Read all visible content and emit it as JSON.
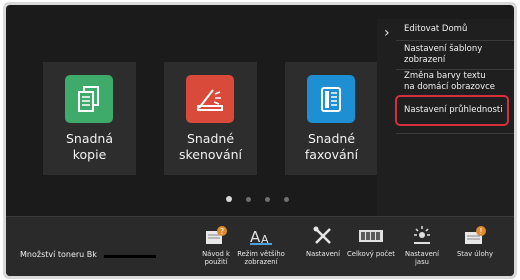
{
  "tiles": [
    {
      "label": "Snadná\nkopie",
      "icon": "copy-icon",
      "color": "#3fab6b"
    },
    {
      "label": "Snadné\nskenování",
      "icon": "scan-icon",
      "color": "#d94a3b"
    },
    {
      "label": "Snadné\nfaxování",
      "icon": "fax-icon",
      "color": "#1f8fd3"
    }
  ],
  "page_indicator": {
    "pages": 4,
    "current": 1
  },
  "menu": {
    "items": [
      {
        "label": "Editovat Domů"
      },
      {
        "label": "Nastavení šablony\nzobrazení"
      },
      {
        "label": "Změna barvy textu\nna domácí obrazovce"
      },
      {
        "label": "Nastavení průhlednosti",
        "highlighted": true
      }
    ],
    "highlight_color": "#d3303c"
  },
  "bottom_bar": {
    "toner_label": "Množství toneru Bk",
    "items": [
      {
        "label": "Návod k\npoužití",
        "icon": "manual-icon"
      },
      {
        "label": "Režim většího\nzobrazení",
        "icon": "large-text-icon"
      },
      {
        "label": "Nastavení",
        "icon": "settings-tools-icon"
      },
      {
        "label": "Celkový počet",
        "icon": "counter-icon"
      },
      {
        "label": "Nastavení\njasu",
        "icon": "brightness-icon"
      },
      {
        "label": "Stav úlohy",
        "icon": "job-status-icon"
      }
    ]
  }
}
